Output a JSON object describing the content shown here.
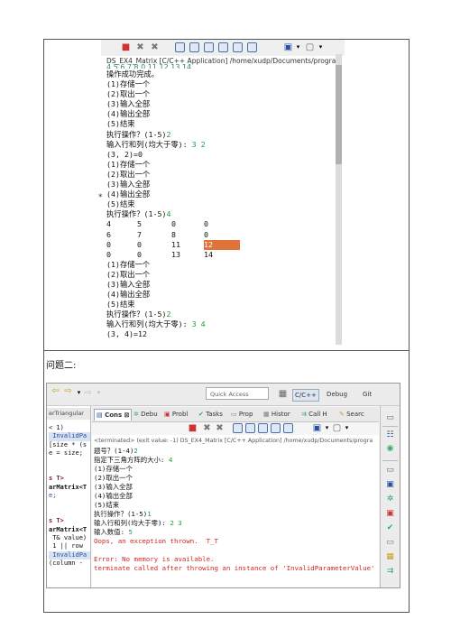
{
  "shot1": {
    "header": "DS_EX4_Matrix [C/C++ Application] /home/xudp/Documents/progra",
    "cut_line": "4 5 6 7 8 0 11 12 13 14",
    "lines": [
      {
        "t": "操作成功完成。"
      },
      {
        "t": "(1)存储一个"
      },
      {
        "t": "(2)取出一个"
      },
      {
        "t": "(3)输入全部"
      },
      {
        "t": "(4)输出全部"
      },
      {
        "t": "(5)结束"
      },
      {
        "t": "执行操作？(1-5)",
        "in": "2"
      },
      {
        "t": "输入行和列(均大于零): ",
        "in": "3 2"
      },
      {
        "t": "(3, 2)=0"
      },
      {
        "t": "(1)存储一个"
      },
      {
        "t": "(2)取出一个"
      },
      {
        "t": "(3)输入全部"
      },
      {
        "t": "(4)输出全部"
      },
      {
        "t": "(5)结束"
      },
      {
        "t": "执行操作？(1-5)",
        "in": "4"
      }
    ],
    "matrix": [
      [
        "4",
        "5",
        "0",
        "0"
      ],
      [
        "6",
        "7",
        "8",
        "0"
      ],
      [
        "0",
        "0",
        "11",
        "12"
      ],
      [
        "0",
        "0",
        "13",
        "14"
      ]
    ],
    "highlight_cell": {
      "row": 2,
      "col": 3
    },
    "lines_after": [
      {
        "t": "(1)存储一个"
      },
      {
        "t": "(2)取出一个"
      },
      {
        "t": "(3)输入全部"
      },
      {
        "t": "(4)输出全部"
      },
      {
        "t": "(5)结束"
      },
      {
        "t": "执行操作？(1-5)",
        "in": "2"
      },
      {
        "t": "输入行和列(均大于零): ",
        "in": "3 4"
      },
      {
        "t": "(3, 4)=12"
      }
    ],
    "margin_marker": "*",
    "colors": {
      "input": "#1a9e3c",
      "highlight": "#e0733a"
    }
  },
  "caption": "问题二:",
  "shot2": {
    "quick_access": "Quick Access",
    "perspectives": [
      "C/C++",
      "Debug",
      "Git"
    ],
    "left_tab": "erTriangular",
    "left_code": [
      {
        "t": "< 1)",
        "s": ""
      },
      {
        "t": " InvalidPa",
        "s": "hi"
      },
      {
        "t": "[size * (s",
        "s": ""
      },
      {
        "t": "e = size;",
        "s": ""
      },
      {
        "t": "",
        "s": ""
      },
      {
        "t": "",
        "s": ""
      },
      {
        "t": "s T>",
        "s": "kw"
      },
      {
        "t": "arMatrix<T",
        "s": "b"
      },
      {
        "t": "e;",
        "s": "blue"
      },
      {
        "t": "",
        "s": ""
      },
      {
        "t": "",
        "s": ""
      },
      {
        "t": "s T>",
        "s": "kw"
      },
      {
        "t": "arMatrix<T",
        "s": "b"
      },
      {
        "t": " T& value)",
        "s": ""
      },
      {
        "t": " 1 || row",
        "s": ""
      },
      {
        "t": " InvalidPa",
        "s": "hi"
      },
      {
        "t": "(column -",
        "s": ""
      }
    ],
    "tabs": [
      "Cons",
      "Debu",
      "Probl",
      "Tasks",
      "Prop",
      "Histor",
      "Call H",
      "Searc"
    ],
    "terminated": "<terminated> (exit value: -1) DS_EX4_Matrix [C/C++ Application] /home/xudp/Documents/progra",
    "lines": [
      {
        "t": "题号？(1-4)",
        "in": "2",
        "cls": ""
      },
      {
        "t": "指定下三角方阵的大小: ",
        "in": "4",
        "cls": ""
      },
      {
        "t": "(1)存储一个",
        "in": "",
        "cls": ""
      },
      {
        "t": "(2)取出一个",
        "in": "",
        "cls": ""
      },
      {
        "t": "(3)输入全部",
        "in": "",
        "cls": ""
      },
      {
        "t": "(4)输出全部",
        "in": "",
        "cls": ""
      },
      {
        "t": "(5)结束",
        "in": "",
        "cls": ""
      },
      {
        "t": "执行操作？(1-5)",
        "in": "1",
        "cls": ""
      },
      {
        "t": "输入行和列(均大于零): ",
        "in": "2 3",
        "cls": ""
      },
      {
        "t": "输入数值: ",
        "in": "5",
        "cls": ""
      },
      {
        "t": "Oops, an exception thrown.  T_T",
        "in": "",
        "cls": "err"
      },
      {
        "t": "",
        "in": "",
        "cls": ""
      },
      {
        "t": "Error: No memory is available.",
        "in": "",
        "cls": "err"
      },
      {
        "t": "terminate called after throwing an instance of 'InvalidParameterValue'",
        "in": "",
        "cls": "err"
      }
    ],
    "colors": {
      "error": "#d22424",
      "input": "#1a9e3c"
    }
  }
}
